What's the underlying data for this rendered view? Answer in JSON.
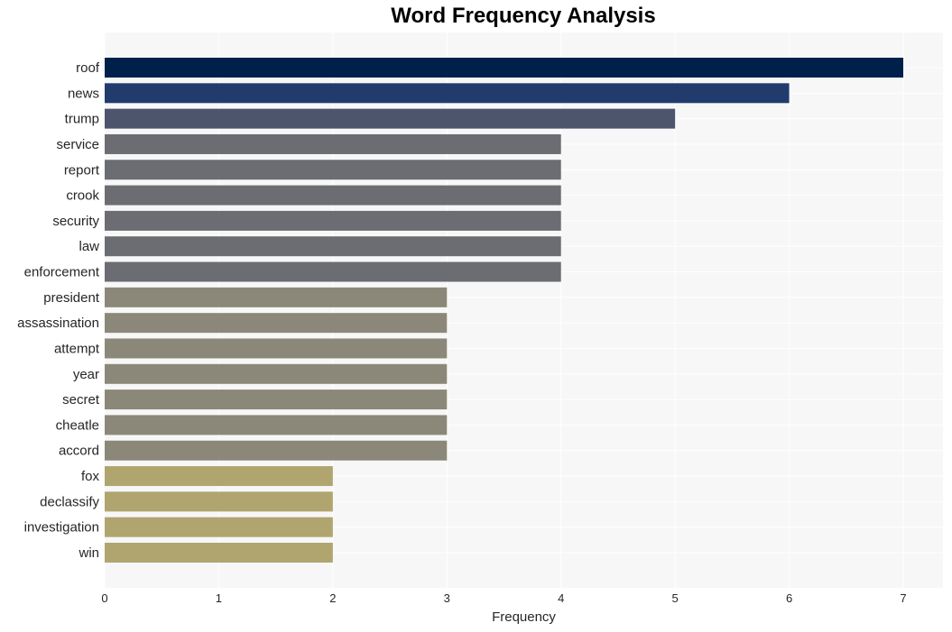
{
  "chart_data": {
    "type": "bar",
    "orientation": "horizontal",
    "title": "Word Frequency Analysis",
    "xlabel": "Frequency",
    "ylabel": "",
    "xlim": [
      0,
      7.35
    ],
    "xticks": [
      0,
      1,
      2,
      3,
      4,
      5,
      6,
      7
    ],
    "grid": true,
    "categories": [
      "roof",
      "news",
      "trump",
      "service",
      "report",
      "crook",
      "security",
      "law",
      "enforcement",
      "president",
      "assassination",
      "attempt",
      "year",
      "secret",
      "cheatle",
      "accord",
      "fox",
      "declassify",
      "investigation",
      "win"
    ],
    "values": [
      7,
      6,
      5,
      4,
      4,
      4,
      4,
      4,
      4,
      3,
      3,
      3,
      3,
      3,
      3,
      3,
      2,
      2,
      2,
      2
    ],
    "colors": [
      "#00204c",
      "#213b6c",
      "#4c556c",
      "#6b6d72",
      "#6b6d72",
      "#6b6d72",
      "#6b6d72",
      "#6b6d72",
      "#6b6d72",
      "#8c8879",
      "#8c8879",
      "#8c8879",
      "#8c8879",
      "#8c8879",
      "#8c8879",
      "#8c8879",
      "#b0a56f",
      "#b0a56f",
      "#b0a56f",
      "#b0a56f"
    ],
    "background": "#f7f7f7"
  }
}
